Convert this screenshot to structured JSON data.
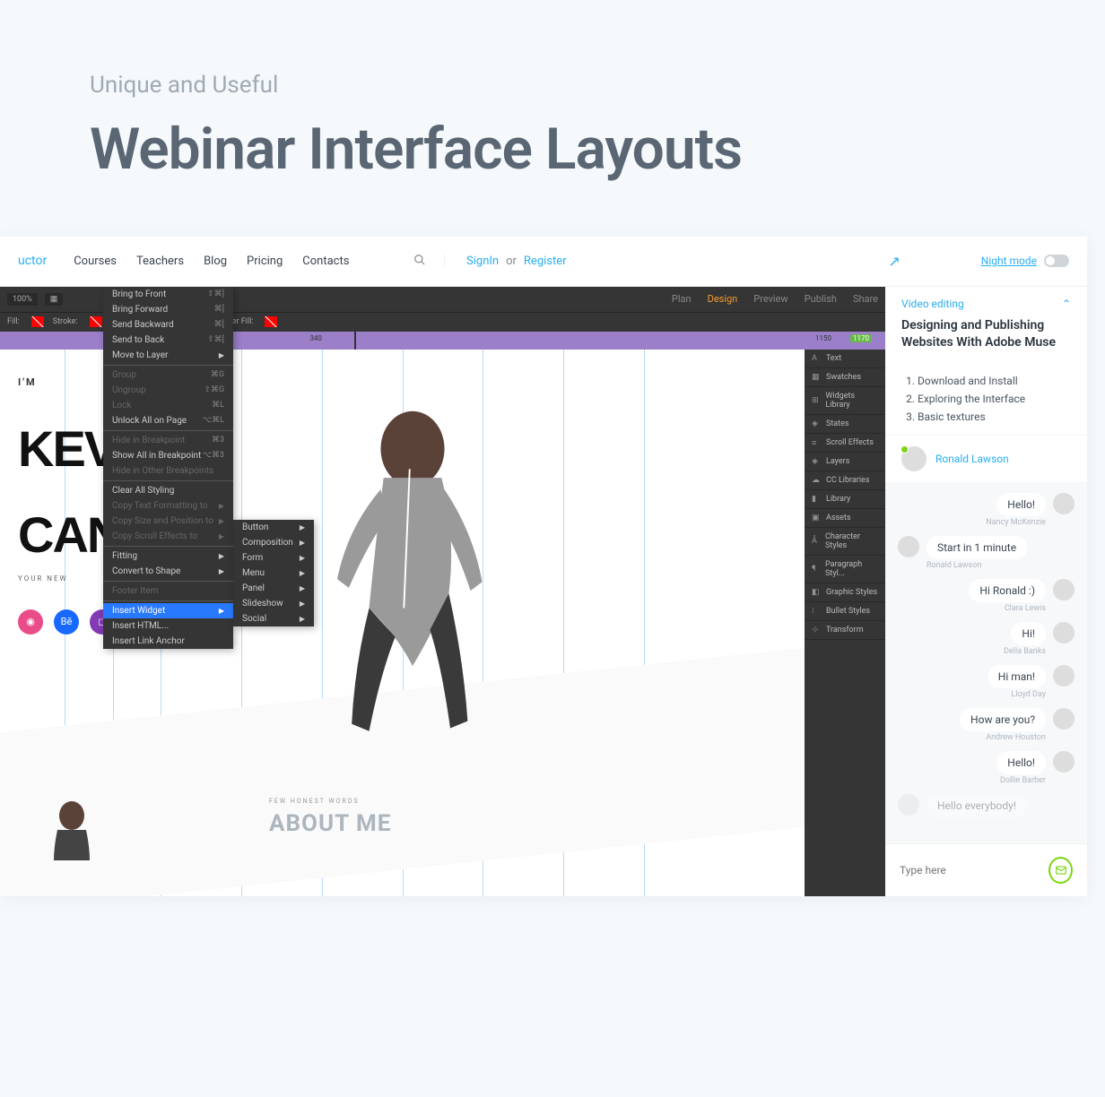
{
  "header": {
    "subtitle": "Unique and Useful",
    "title": "Webinar Interface Layouts"
  },
  "nav": {
    "logo": "uctor",
    "links": [
      "Courses",
      "Teachers",
      "Blog",
      "Pricing",
      "Contacts"
    ],
    "signin": "SignIn",
    "or": "or",
    "register": "Register",
    "night_mode": "Night mode"
  },
  "editor": {
    "zoom": "100%",
    "modes": {
      "plan": "Plan",
      "design": "Design",
      "preview": "Preview",
      "publish": "Publish",
      "share": "Share"
    },
    "fill_label": "Fill:",
    "stroke_label": "Stroke:",
    "browser_fill": "Browser Fill:",
    "ruler_marks": [
      "340",
      "1150",
      "1170"
    ],
    "context_menu": [
      {
        "label": "Bring to Front",
        "sc": "⇧⌘]"
      },
      {
        "label": "Bring Forward",
        "sc": "⌘]"
      },
      {
        "label": "Send Backward",
        "sc": "⌘["
      },
      {
        "label": "Send to Back",
        "sc": "⇧⌘["
      },
      {
        "label": "Move to Layer",
        "arrow": true
      },
      {
        "sep": true
      },
      {
        "label": "Group",
        "sc": "⌘G",
        "disabled": true
      },
      {
        "label": "Ungroup",
        "sc": "⇧⌘G",
        "disabled": true
      },
      {
        "label": "Lock",
        "sc": "⌘L",
        "disabled": true
      },
      {
        "label": "Unlock All on Page",
        "sc": "⌥⌘L"
      },
      {
        "sep": true
      },
      {
        "label": "Hide in Breakpoint",
        "sc": "⌘3",
        "disabled": true
      },
      {
        "label": "Show All in Breakpoint",
        "sc": "⌥⌘3"
      },
      {
        "label": "Hide in Other Breakpoints",
        "disabled": true
      },
      {
        "sep": true
      },
      {
        "label": "Clear All Styling"
      },
      {
        "label": "Copy Text Formatting to",
        "arrow": true,
        "disabled": true
      },
      {
        "label": "Copy Size and Position to",
        "arrow": true,
        "disabled": true
      },
      {
        "label": "Copy Scroll Effects to",
        "arrow": true,
        "disabled": true
      },
      {
        "sep": true
      },
      {
        "label": "Fitting",
        "arrow": true
      },
      {
        "label": "Convert to Shape",
        "arrow": true
      },
      {
        "sep": true
      },
      {
        "label": "Footer Item",
        "disabled": true
      },
      {
        "sep": true
      },
      {
        "label": "Insert Widget",
        "arrow": true,
        "hl": true
      },
      {
        "label": "Insert HTML..."
      },
      {
        "label": "Insert Link Anchor"
      }
    ],
    "submenu": [
      "Button",
      "Composition",
      "Form",
      "Menu",
      "Panel",
      "Slideshow",
      "Social"
    ],
    "panels": [
      "Text",
      "Swatches",
      "Widgets Library",
      "States",
      "Scroll Effects",
      "Layers",
      "CC Libraries",
      "Library",
      "Assets",
      "Character Styles",
      "Paragraph Styl...",
      "Graphic Styles",
      "Bullet Styles",
      "Transform"
    ],
    "canvas": {
      "im": "I'M",
      "name1": "KEV",
      "name2": "CAN",
      "tagline": "YOUR NEW",
      "about_pre": "FEW HONEST WORDS",
      "about_h": "ABOUT ME"
    }
  },
  "sidebar": {
    "category": "Video editing",
    "title": "Designing and Publishing Websites With Adobe Muse",
    "lessons": [
      "Download and Install",
      "Exploring the Interface",
      "Basic textures"
    ],
    "presenter": "Ronald Lawson",
    "chat": [
      {
        "side": "right",
        "text": "Hello!",
        "name": "Nancy McKenzie"
      },
      {
        "side": "left",
        "text": "Start in 1 minute",
        "name": "Ronald Lawson"
      },
      {
        "side": "right",
        "text": "Hi Ronald :)",
        "name": "Clara Lewis"
      },
      {
        "side": "right",
        "text": "Hi!",
        "name": "Della Banks"
      },
      {
        "side": "right",
        "text": "Hi man!",
        "name": "Lloyd Day"
      },
      {
        "side": "right",
        "text": "How are you?",
        "name": "Andrew Houston"
      },
      {
        "side": "right",
        "text": "Hello!",
        "name": "Dollie Barber"
      }
    ],
    "input_placeholder": "Type here",
    "input_ghost": "Hello everybody!"
  }
}
